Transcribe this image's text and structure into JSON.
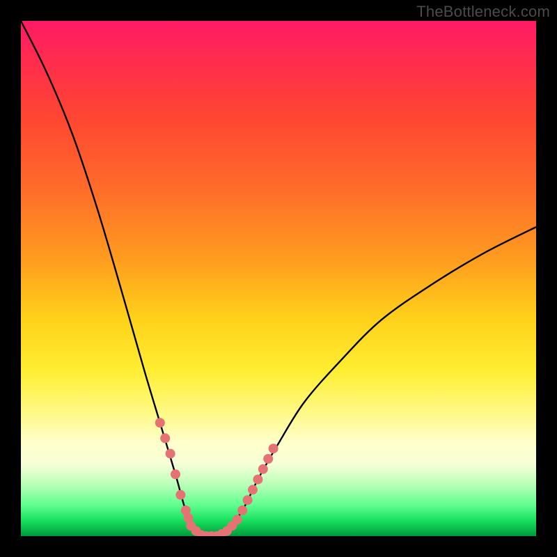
{
  "watermark": {
    "text": "TheBottleneck.com"
  },
  "colors": {
    "background": "#000000",
    "curve": "#000000",
    "marker": "#e57373",
    "gradient_top": "#ff1a66",
    "gradient_bottom": "#009a3a"
  },
  "chart_data": {
    "type": "line",
    "title": "",
    "xlabel": "",
    "ylabel": "",
    "xlim": [
      0,
      100
    ],
    "ylim": [
      0,
      100
    ],
    "grid": false,
    "legend": false,
    "description": "V-shaped bottleneck curve over a rainbow gradient. Y≈100 at left edge, drops steeply, reaches ≈0 near x≈34, stays near 0 until x≈40, then rises with decreasing slope to ≈60 at right edge. Salmon-colored dotted markers around the valley floor and lower limbs.",
    "series": [
      {
        "name": "bottleneck-curve",
        "x": [
          0,
          5,
          10,
          15,
          20,
          24,
          27,
          30,
          32,
          34,
          36,
          38,
          40,
          43,
          46,
          50,
          55,
          62,
          70,
          80,
          90,
          100
        ],
        "y": [
          100,
          90,
          78,
          63,
          46,
          32,
          22,
          12,
          5,
          1,
          0,
          0,
          1,
          5,
          11,
          18,
          26,
          34,
          42,
          49,
          55,
          60
        ]
      }
    ],
    "markers": {
      "name": "valley-dots",
      "x": [
        27,
        28,
        29,
        30,
        31,
        32,
        32.5,
        33,
        34,
        35,
        36,
        37,
        38,
        39,
        40,
        41,
        42,
        43,
        44,
        45,
        46,
        47,
        48,
        49
      ],
      "y": [
        22,
        19,
        16,
        12,
        8,
        5,
        3.5,
        2,
        1,
        0.2,
        0,
        0,
        0,
        0.4,
        1,
        2,
        3.2,
        5,
        7,
        9,
        11,
        13,
        15,
        17
      ]
    }
  }
}
